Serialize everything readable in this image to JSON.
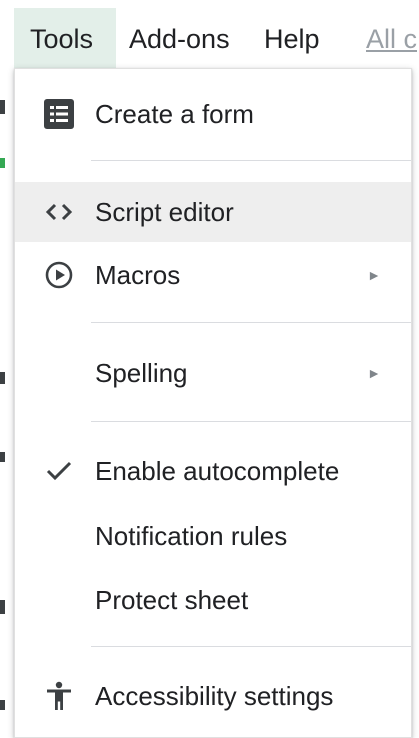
{
  "menubar": {
    "tools": "Tools",
    "addons": "Add-ons",
    "help": "Help",
    "all_changes": "All c"
  },
  "menu": {
    "items": [
      {
        "label": "Create a form",
        "icon": "form-icon",
        "submenu": false
      },
      {
        "label": "Script editor",
        "icon": "code-icon",
        "submenu": false,
        "highlighted": true
      },
      {
        "label": "Macros",
        "icon": "play-circle-icon",
        "submenu": true
      },
      {
        "label": "Spelling",
        "icon": "",
        "submenu": true
      },
      {
        "label": "Enable autocomplete",
        "icon": "check-icon",
        "submenu": false,
        "checked": true
      },
      {
        "label": "Notification rules",
        "icon": "",
        "submenu": false
      },
      {
        "label": "Protect sheet",
        "icon": "",
        "submenu": false
      },
      {
        "label": "Accessibility settings",
        "icon": "accessibility-icon",
        "submenu": false
      }
    ],
    "submenu_arrow": "►"
  },
  "colors": {
    "active_menubar_bg": "#e3efe9",
    "hover_item_bg": "#eeeeee",
    "divider": "#dadce0",
    "icon": "#3c4043"
  }
}
